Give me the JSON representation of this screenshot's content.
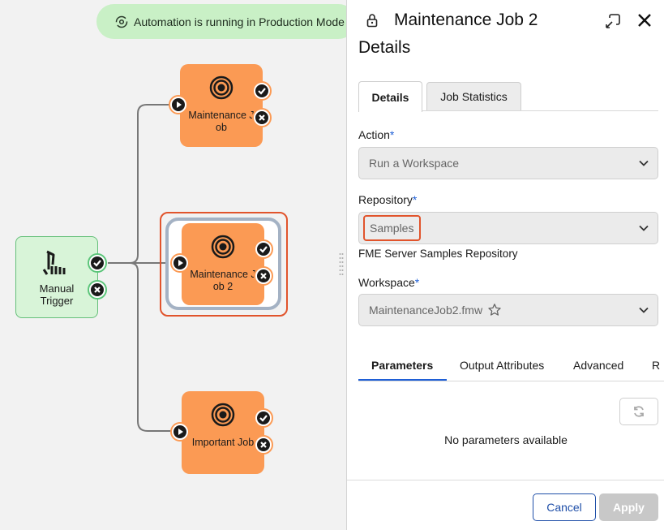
{
  "banner": {
    "text": "Automation is running in Production Mode",
    "icon": "refresh-cog-icon",
    "color": "#c9f0c6"
  },
  "canvas": {
    "trigger": {
      "label_line1": "Manual",
      "label_line2": "Trigger",
      "icon": "hand-pointer-icon"
    },
    "jobs": [
      {
        "label": "Maintenance Job",
        "icon": "target-icon"
      },
      {
        "label": "Maintenance Job 2",
        "icon": "target-icon",
        "selected": true
      },
      {
        "label": "Important Job",
        "icon": "target-icon"
      }
    ],
    "colors": {
      "job": "#fb9a54",
      "trigger": "#d8f4d8",
      "selection": "#e1542c"
    }
  },
  "panel": {
    "title": "Maintenance Job 2",
    "section_title": "Details",
    "tabs": [
      "Details",
      "Job Statistics"
    ],
    "active_tab": "Details",
    "action": {
      "label": "Action",
      "value": "Run a Workspace"
    },
    "repository": {
      "label": "Repository",
      "value": "Samples",
      "description": "FME Server Samples Repository"
    },
    "workspace": {
      "label": "Workspace",
      "value": "MaintenanceJob2.fmw"
    },
    "required_marker": "*",
    "sub_tabs": [
      "Parameters",
      "Output Attributes",
      "Advanced",
      "R"
    ],
    "active_sub_tab": "Parameters",
    "empty_message": "No parameters available",
    "buttons": {
      "cancel": "Cancel",
      "apply": "Apply"
    },
    "colors": {
      "accent": "#1f5fd6",
      "cancel": "#1f4fa8",
      "apply_disabled": "#c8c8c8"
    }
  }
}
